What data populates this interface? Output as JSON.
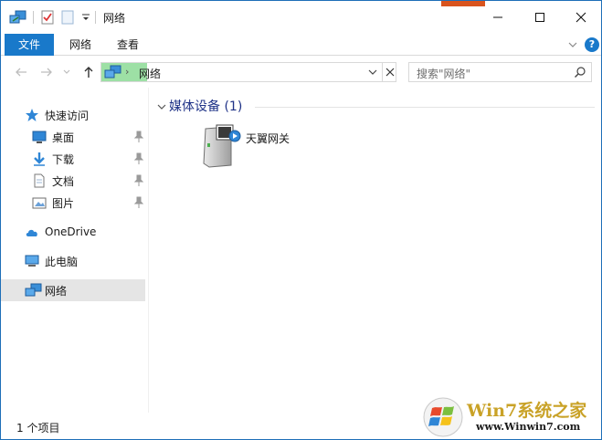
{
  "window": {
    "title": "网络",
    "colors": {
      "accent": "#1979ca",
      "selected": "#e5e5e5",
      "group_title": "#1e3287",
      "address_highlight": "#9de0a5"
    }
  },
  "ribbon": {
    "tabs": [
      {
        "label": "文件"
      },
      {
        "label": "网络"
      },
      {
        "label": "查看"
      }
    ],
    "help_label": "?"
  },
  "address": {
    "path_label": "网络",
    "search_placeholder": "搜索\"网络\""
  },
  "sidebar": {
    "quick_access": "快速访问",
    "quick_items": [
      {
        "label": "桌面",
        "icon": "desktop-icon"
      },
      {
        "label": "下载",
        "icon": "download-icon"
      },
      {
        "label": "文档",
        "icon": "document-icon"
      },
      {
        "label": "图片",
        "icon": "picture-icon"
      }
    ],
    "onedrive": "OneDrive",
    "this_pc": "此电脑",
    "network": "网络"
  },
  "content": {
    "group_title": "媒体设备 (1)",
    "items": [
      {
        "label": "天翼网关",
        "icon": "media-device-icon"
      }
    ]
  },
  "status": {
    "item_count": "1 个项目"
  },
  "watermark": {
    "title": "Win7系统之家",
    "url": "www.Winwin7.com"
  }
}
